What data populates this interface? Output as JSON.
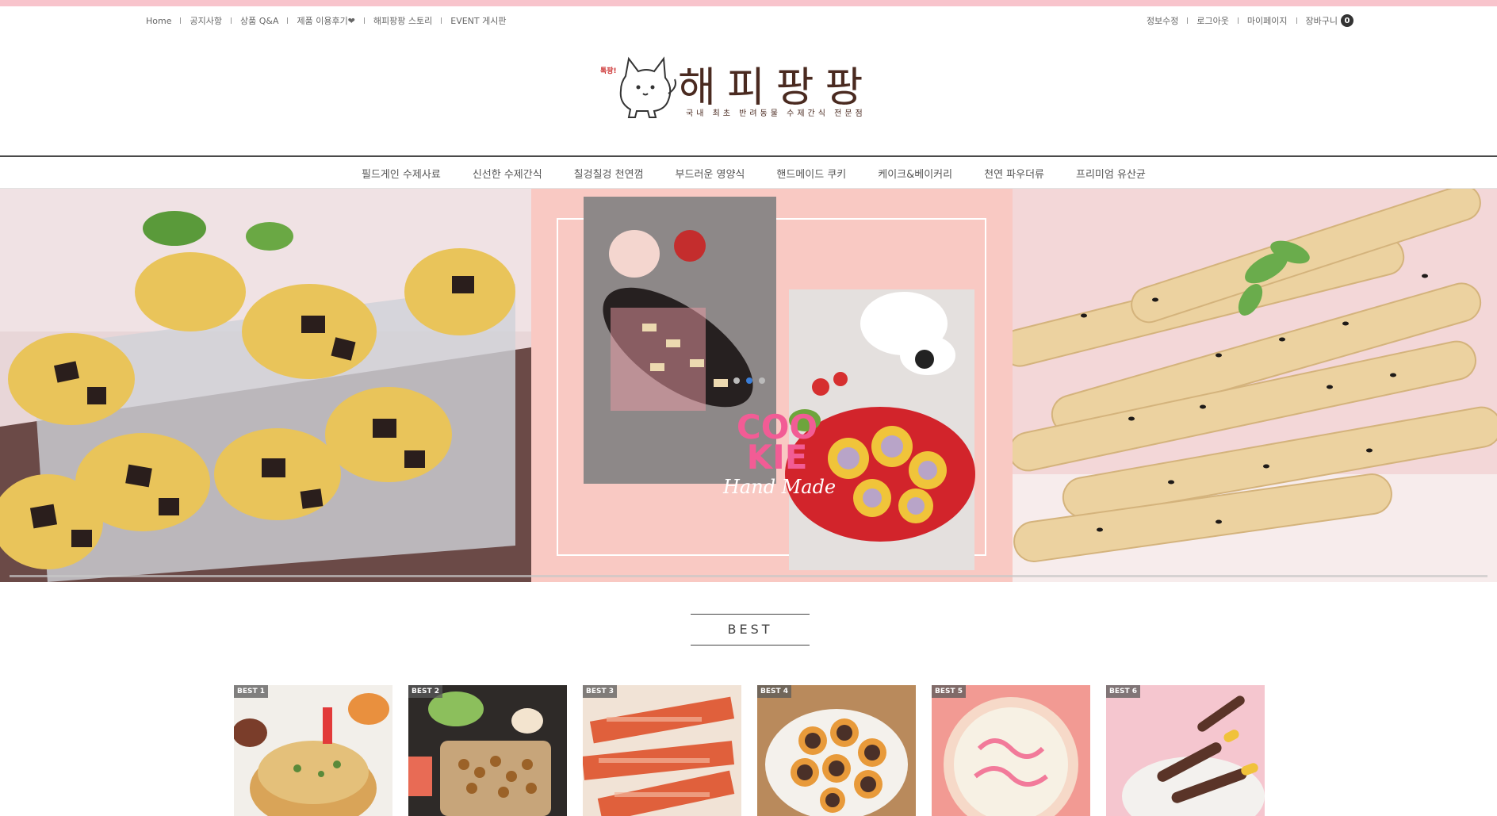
{
  "util_left": [
    "Home",
    "공지사항",
    "상품 Q&A",
    "제품 이용후기❤",
    "해피팡팡 스토리",
    "EVENT 게시판"
  ],
  "util_right": [
    "정보수정",
    "로그아웃",
    "마이페이지",
    "장바구니"
  ],
  "cart_count": "0",
  "logo": {
    "bubble": "톡팡!",
    "title": "해피팡팡",
    "subtitle": "국내 최초 반려동물 수제간식 전문점"
  },
  "nav": [
    "필드게인 수제사료",
    "신선한 수제간식",
    "칠겅칠겅 천연껌",
    "부드러운 영양식",
    "핸드메이드 쿠키",
    "케이크&베이커리",
    "천연 파우더류",
    "프리미엄 유산균"
  ],
  "hero": {
    "cookie_line1": "COO",
    "cookie_line2": "KIE",
    "handmade": "Hand Made",
    "active_slide": 2
  },
  "best": {
    "title": "BEST",
    "items": [
      {
        "badge": "BEST 1"
      },
      {
        "badge": "BEST 2"
      },
      {
        "badge": "BEST 3"
      },
      {
        "badge": "BEST 4"
      },
      {
        "badge": "BEST 5"
      },
      {
        "badge": "BEST 6"
      }
    ]
  },
  "colors": {
    "top_strip": "#f8c4cc",
    "hero_center_bg": "#f9c9c3",
    "cookie_pink": "#f25c95",
    "dot_active": "#3b7ed8"
  }
}
